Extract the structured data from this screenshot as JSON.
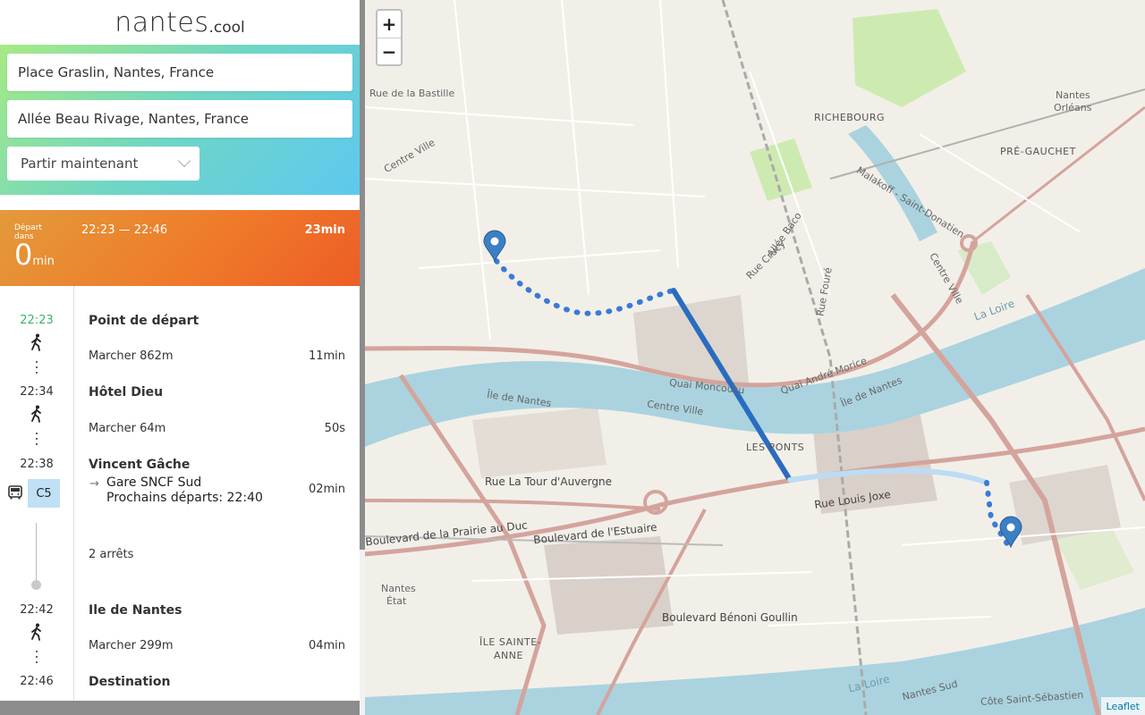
{
  "logo": {
    "big": "nantes",
    "small": ".cool"
  },
  "search": {
    "from": "Place Graslin, Nantes, France",
    "to": "Allée Beau Rivage, Nantes, France",
    "when": "Partir maintenant"
  },
  "trip": {
    "depart_label": "Départ dans",
    "depart_value": "0",
    "depart_unit": "min",
    "times": "22:23 — 22:46",
    "duration": "23min"
  },
  "steps": {
    "t1": "22:23",
    "start": "Point de départ",
    "walk1": "Marcher 862m",
    "walk1_dur": "11min",
    "t2": "22:34",
    "stop1": "Hôtel Dieu",
    "walk2": "Marcher 64m",
    "walk2_dur": "50s",
    "t3": "22:38",
    "stop2": "Vincent Gâche",
    "line": "C5",
    "direction": "Gare SNCF Sud",
    "next_departures": "Prochains départs: 22:40",
    "bus_dur": "02min",
    "stops_count": "2 arrêts",
    "t4": "22:42",
    "stop3": "Ile de Nantes",
    "walk3": "Marcher 299m",
    "walk3_dur": "04min",
    "t5": "22:46",
    "destination": "Destination"
  },
  "map": {
    "zoom_in": "+",
    "zoom_out": "−",
    "attribution": "Leaflet",
    "labels": {
      "richebourg": "RICHEBOURG",
      "pre_gauchet": "PRÉ-GAUCHET",
      "nantes_orleans_1": "Nantes",
      "nantes_orleans_2": "Orléans",
      "rue_bastille": "Rue de la Bastille",
      "quai_moncousu": "Quai Moncousu",
      "quai_andre_morice": "Quai André Morice",
      "ile_de_nantes_1": "Île de Nantes",
      "ile_de_nantes_2": "Île de Nantes",
      "centre_ville_1": "Centre Ville",
      "centre_ville_2": "Centre Ville",
      "les_ponts": "LES PONTS",
      "rue_tour_auvergne": "Rue La Tour d'Auvergne",
      "rue_louis_joxe": "Rue Louis Joxe",
      "bd_estuaire": "Boulevard de l'Estuaire",
      "bd_prairie": "Boulevard de la Prairie au Duc",
      "bd_benoni": "Boulevard Bénoni Goullin",
      "ile_sainte_anne_1": "ÎLE SAINTE-",
      "ile_sainte_anne_2": "ANNE",
      "la_loire_1": "La Loire",
      "la_loire_2": "La Loire",
      "nantes_sud": "Nantes Sud",
      "cote_st_sebastien": "Côte Saint-Sébastien",
      "nantes_etat_1": "Nantes",
      "nantes_etat_2": "État",
      "allee_baco": "Allée Baco",
      "rue_crucy": "Rue Crucy",
      "rue_fource": "Rue Fouré",
      "malakoff": "Malakoff - Saint-Donatien",
      "centre_ville_3": "Centre Ville"
    }
  },
  "colors": {
    "walk_route": "#3a7bd5",
    "tram_route": "#2a6cbf",
    "bus_route": "#bcdcf5",
    "river": "#aad3df",
    "marker": "#3b7fc4"
  }
}
